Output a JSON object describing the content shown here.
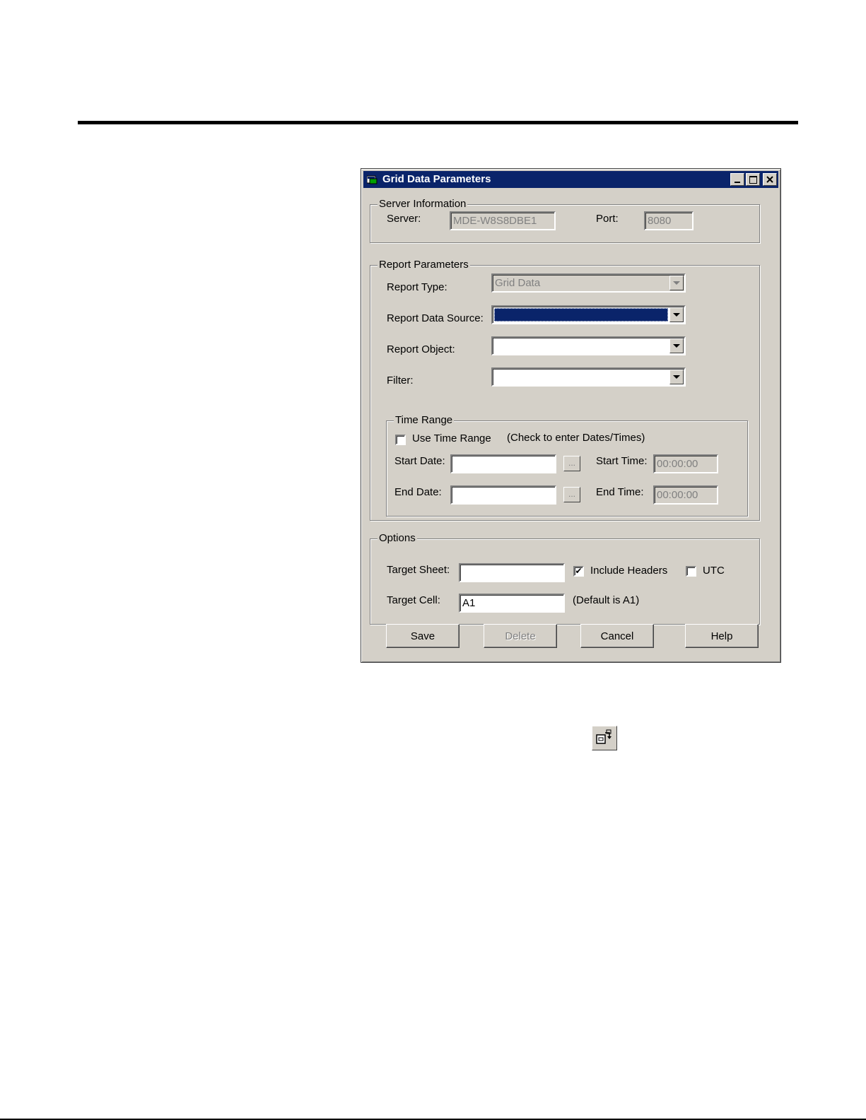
{
  "dialog": {
    "title": "Grid Data Parameters",
    "minimize": "_",
    "maximize": "□",
    "close": "✕"
  },
  "server_info": {
    "group_title": "Server Information",
    "server_label": "Server:",
    "server_value": "MDE-W8S8DBE1",
    "port_label": "Port:",
    "port_value": "8080"
  },
  "report_params": {
    "group_title": "Report Parameters",
    "report_type_label": "Report Type:",
    "report_type_value": "Grid Data",
    "data_source_label": "Report Data Source:",
    "data_source_value": "",
    "object_label": "Report Object:",
    "object_value": "",
    "filter_label": "Filter:",
    "filter_value": ""
  },
  "time_range": {
    "group_title": "Time Range",
    "use_label": "Use Time Range",
    "use_checked": false,
    "hint": "(Check to enter Dates/Times)",
    "start_date_label": "Start Date:",
    "start_date_value": "",
    "end_date_label": "End Date:",
    "end_date_value": "",
    "browse_label": "...",
    "start_time_label": "Start Time:",
    "start_time_value": "00:00:00",
    "end_time_label": "End Time:",
    "end_time_value": "00:00:00"
  },
  "options": {
    "group_title": "Options",
    "target_sheet_label": "Target Sheet:",
    "target_sheet_value": "",
    "include_headers_label": "Include Headers",
    "include_headers_checked": true,
    "utc_label": "UTC",
    "utc_checked": false,
    "target_cell_label": "Target Cell:",
    "target_cell_value": "A1",
    "target_cell_hint": "(Default is A1)"
  },
  "buttons": {
    "save": "Save",
    "delete": "Delete",
    "cancel": "Cancel",
    "help": "Help"
  },
  "check_mark": "✔",
  "colors": {
    "titlebar": "#0a246a",
    "dialog_face": "#d4d0c8",
    "disabled_text": "#808080"
  },
  "icons": [
    "app-icon",
    "minimize-icon",
    "maximize-icon",
    "close-icon",
    "dropdown-arrow-icon",
    "refresh-report-icon"
  ]
}
